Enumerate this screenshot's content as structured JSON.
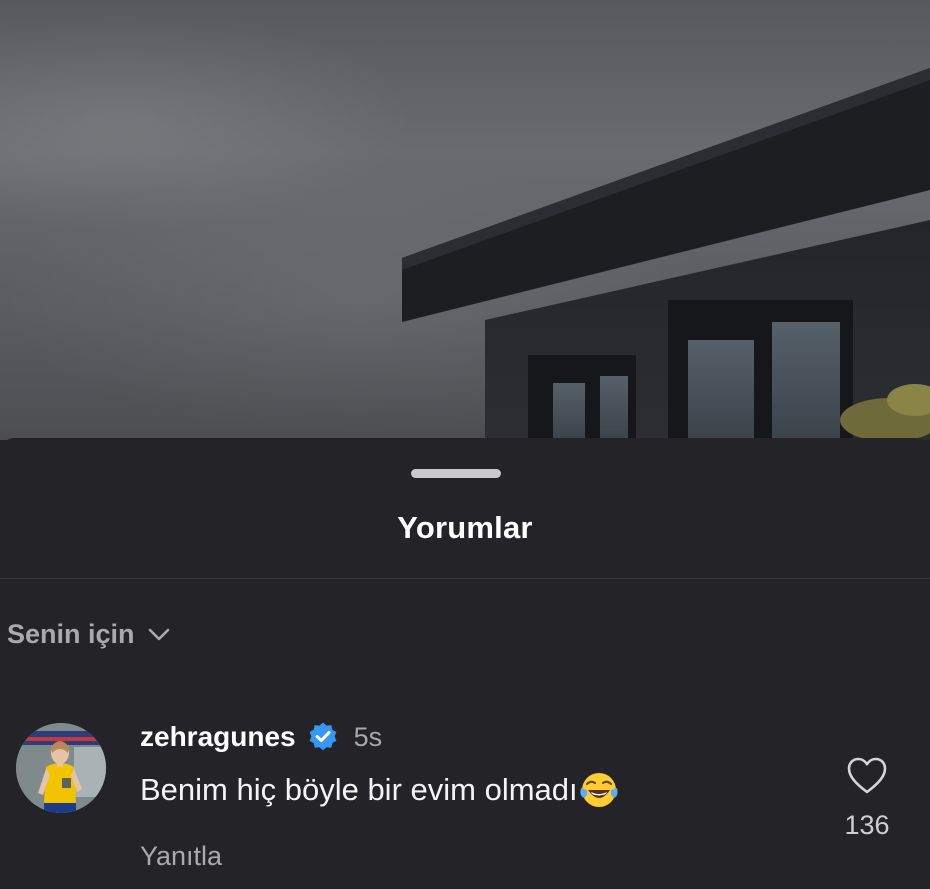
{
  "sheet": {
    "title": "Yorumlar"
  },
  "sort": {
    "label": "Senin için",
    "icon": "chevron-down-icon"
  },
  "comment": {
    "username": "zehragunes",
    "verified": true,
    "verified_icon": "verified-badge-icon",
    "timestamp": "5s",
    "text": "Benim hiç böyle bir evim olmadı",
    "emoji": "face-with-tears-of-joy-icon",
    "reply_label": "Yanıtla",
    "like_icon": "heart-outline-icon",
    "like_count": "136"
  },
  "colors": {
    "sheet_background": "#242428",
    "verified_blue": "#3897f0",
    "secondary_text": "#a9a9ae"
  }
}
